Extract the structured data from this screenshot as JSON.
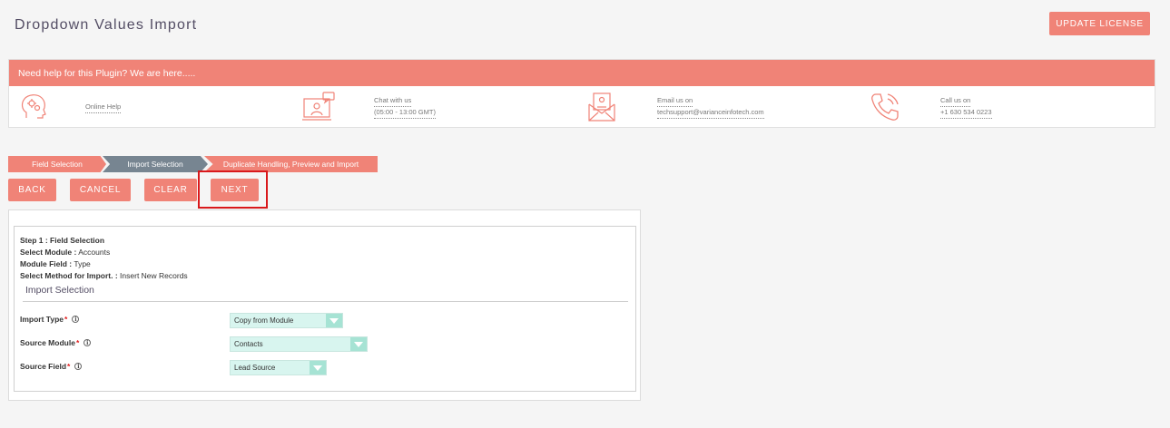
{
  "page": {
    "title": "Dropdown Values Import",
    "update_license": "UPDATE LICENSE"
  },
  "help": {
    "header": "Need help for this Plugin? We are here.....",
    "online_help": "Online Help",
    "chat_label": "Chat with us",
    "chat_hours": "(05:00 - 13:00 GMT)",
    "email_label": "Email us on",
    "email_value": "techsupport@varianceinfotech.com",
    "call_label": "Call us on",
    "call_value": "+1 630 534 0223",
    "icons": [
      "head-gears-icon",
      "chat-monitor-icon",
      "email-envelope-icon",
      "phone-icon"
    ]
  },
  "breadcrumb": [
    "Field Selection",
    "Import Selection",
    "Duplicate Handling, Preview and Import"
  ],
  "actions": {
    "back": "BACK",
    "cancel": "CANCEL",
    "clear": "CLEAR",
    "next": "NEXT"
  },
  "summary": {
    "step_label": "Step 1 : Field Selection",
    "module_label": "Select Module :",
    "module_value": "Accounts",
    "field_label": "Module Field :",
    "field_value": "Type",
    "method_label": "Select Method for Import. :",
    "method_value": "Insert New Records"
  },
  "import_section": {
    "title": "Import Selection",
    "fields": [
      {
        "label": "Import Type",
        "value": "Copy from Module"
      },
      {
        "label": "Source Module",
        "value": "Contacts"
      },
      {
        "label": "Source Field",
        "value": "Lead Source"
      }
    ],
    "required_mark": "*",
    "info_glyph": "i"
  },
  "colors": {
    "accent": "#f08377",
    "active_step": "#778591",
    "select_bg": "#d8f5ef",
    "select_arrow": "#a6e3d4",
    "highlight": "#d9191c"
  }
}
